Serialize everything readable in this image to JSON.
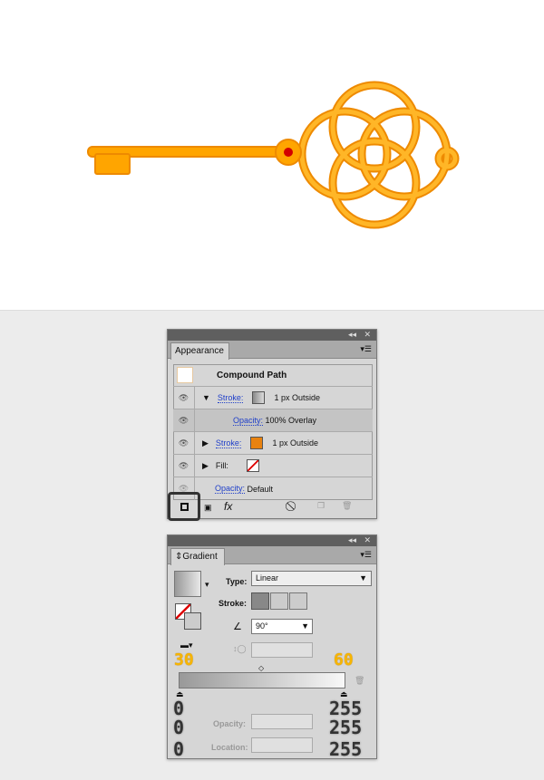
{
  "colors": {
    "key": "#ffa500",
    "key_dark": "#ee8a00",
    "gem": "#d20000",
    "link": "#1f3fc9",
    "highlight": "#f7b500"
  },
  "appearance": {
    "tab": "Appearance",
    "title": "Compound Path",
    "rows": [
      {
        "label": "Stroke:",
        "swatch": "gradient",
        "value": "1 px  Outside",
        "expanded": true
      },
      {
        "label": "Opacity:",
        "value": "100% Overlay"
      },
      {
        "label": "Stroke:",
        "swatch": "#e8820f",
        "value": "1 px  Outside",
        "expanded": false
      },
      {
        "label": "Fill:",
        "swatch": "none"
      },
      {
        "label": "Opacity:",
        "value": "Default"
      }
    ],
    "fx": "fx"
  },
  "gradient": {
    "tab": "Gradient",
    "type_label": "Type:",
    "type_value": "Linear",
    "stroke_label": "Stroke:",
    "angle_value": "90°",
    "left_stop_opacity": "30",
    "right_stop_opacity": "60",
    "left_rgb": [
      "0",
      "0",
      "0"
    ],
    "right_rgb": [
      "255",
      "255",
      "255"
    ],
    "opacity_label": "Opacity:",
    "location_label": "Location:"
  }
}
